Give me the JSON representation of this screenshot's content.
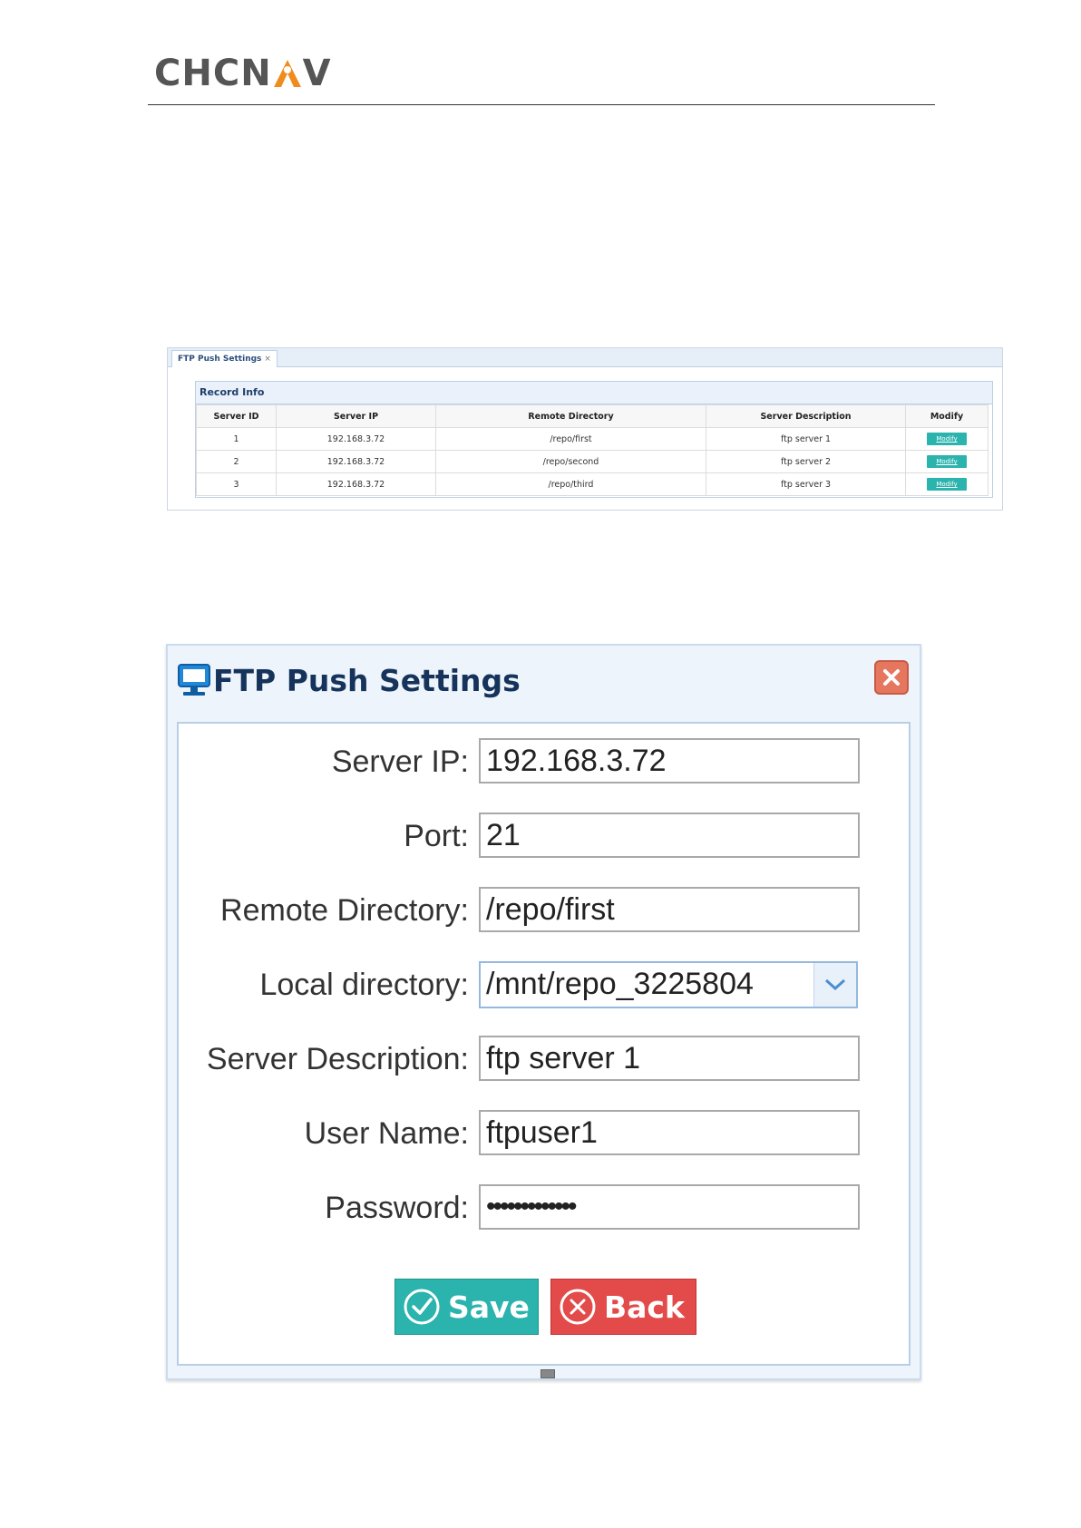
{
  "header": {
    "logo_left": "CHCN",
    "logo_right": "V"
  },
  "records_panel": {
    "tab_label": "FTP Push Settings",
    "tab_close": "×",
    "title": "Record Info",
    "columns": [
      "Server ID",
      "Server IP",
      "Remote Directory",
      "Server Description",
      "Modify"
    ],
    "rows": [
      {
        "id": "1",
        "ip": "192.168.3.72",
        "dir": "/repo/first",
        "desc": "ftp server 1",
        "action": "Modify"
      },
      {
        "id": "2",
        "ip": "192.168.3.72",
        "dir": "/repo/second",
        "desc": "ftp server 2",
        "action": "Modify"
      },
      {
        "id": "3",
        "ip": "192.168.3.72",
        "dir": "/repo/third",
        "desc": "ftp server 3",
        "action": "Modify"
      }
    ]
  },
  "dialog": {
    "title": "FTP Push Settings",
    "fields": {
      "server_ip": {
        "label": "Server IP:",
        "value": "192.168.3.72"
      },
      "port": {
        "label": "Port:",
        "value": "21"
      },
      "remote_dir": {
        "label": "Remote Directory:",
        "value": "/repo/first"
      },
      "local_dir": {
        "label": "Local directory:",
        "value": "/mnt/repo_3225804"
      },
      "server_desc": {
        "label": "Server Description:",
        "value": "ftp server 1"
      },
      "user_name": {
        "label": "User Name:",
        "value": "ftpuser1"
      },
      "password": {
        "label": "Password:",
        "value": "•••••••••••••"
      }
    },
    "save_label": "Save",
    "back_label": "Back"
  },
  "colors": {
    "accent_teal": "#2bb3ad",
    "danger_red": "#e34a4a",
    "logo_orange": "#f08c1e",
    "title_navy": "#15335b"
  },
  "icons": [
    "pin-a-icon",
    "computer-icon",
    "close-icon",
    "chevron-down-icon",
    "check-circle-icon",
    "x-circle-icon"
  ]
}
